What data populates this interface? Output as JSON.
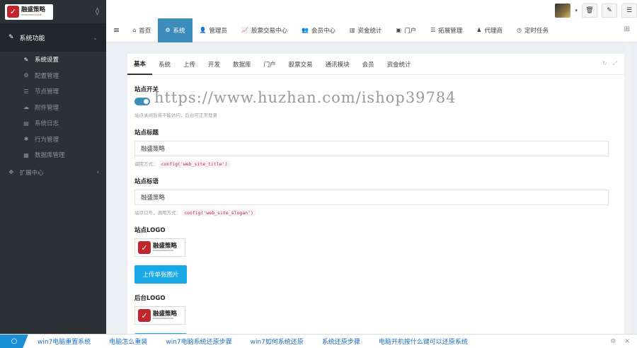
{
  "sidebar": {
    "logo_cn": "融盛策略",
    "logo_en": "RONGSHENGCELVE",
    "section_label": "系统功能",
    "items": [
      {
        "label": "系统设置",
        "icon": "wrench-icon",
        "glyph": "✎",
        "active": true
      },
      {
        "label": "配置管理",
        "icon": "cogs-icon",
        "glyph": "⚙",
        "active": false
      },
      {
        "label": "节点管理",
        "icon": "list-icon",
        "glyph": "☰",
        "active": false
      },
      {
        "label": "附件管理",
        "icon": "cloud-upload-icon",
        "glyph": "☁",
        "active": false
      },
      {
        "label": "系统日志",
        "icon": "book-icon",
        "glyph": "▤",
        "active": false
      },
      {
        "label": "行为管理",
        "icon": "asterisk-icon",
        "glyph": "✱",
        "active": false
      },
      {
        "label": "数据库管理",
        "icon": "database-icon",
        "glyph": "▦",
        "active": false
      }
    ],
    "ext_label": "扩展中心"
  },
  "topnav": {
    "tabs": [
      {
        "label": "首页",
        "icon": "home-icon",
        "glyph": "⌂"
      },
      {
        "label": "系统",
        "icon": "gear-icon",
        "glyph": "⚙",
        "active": true
      },
      {
        "label": "管理员",
        "icon": "user-icon",
        "glyph": "👤"
      },
      {
        "label": "股票交易中心",
        "icon": "line-chart-icon",
        "glyph": "📈"
      },
      {
        "label": "会员中心",
        "icon": "users-icon",
        "glyph": "👥"
      },
      {
        "label": "资金统计",
        "icon": "bar-chart-icon",
        "glyph": "▥"
      },
      {
        "label": "门户",
        "icon": "portal-icon",
        "glyph": "▣"
      },
      {
        "label": "拓展管理",
        "icon": "list-icon",
        "glyph": "☰"
      },
      {
        "label": "代理商",
        "icon": "person-icon",
        "glyph": "♟"
      },
      {
        "label": "定时任务",
        "icon": "clock-icon",
        "glyph": "◷"
      }
    ]
  },
  "panel": {
    "tabs": [
      "基本",
      "系统",
      "上传",
      "开发",
      "数据库",
      "门户",
      "股票交易",
      "通讯模块",
      "会员",
      "资金统计"
    ],
    "site_switch_label": "站点开关",
    "site_switch_hint": "站点关闭后将不能访问，后台可正常登录",
    "site_title_label": "站点标题",
    "site_title_value": "融盛策略",
    "site_title_hint": "调用方式：",
    "site_title_code": "config('web_site_title')",
    "site_slogan_label": "站点标语",
    "site_slogan_value": "融盛策略",
    "site_slogan_hint": "站点口号，调用方式：",
    "site_slogan_code": "config('web_site_slogan')",
    "site_logo_label": "站点LOGO",
    "upload_single_label": "上传单张图片",
    "admin_logo_label": "后台LOGO"
  },
  "watermark": "https://www.huzhan.com/ishop39784",
  "bottombar": {
    "links": [
      "win7电脑重置系统",
      "电脑怎么重装",
      "win7电脑系统还原步骤",
      "win7如何系统还原",
      "系统还原步骤",
      "电脑开机按什么键可以还原系统"
    ]
  },
  "colors": {
    "accent": "#3c8dbc",
    "upload": "#18a9e6",
    "sidebar": "#2b3135"
  }
}
